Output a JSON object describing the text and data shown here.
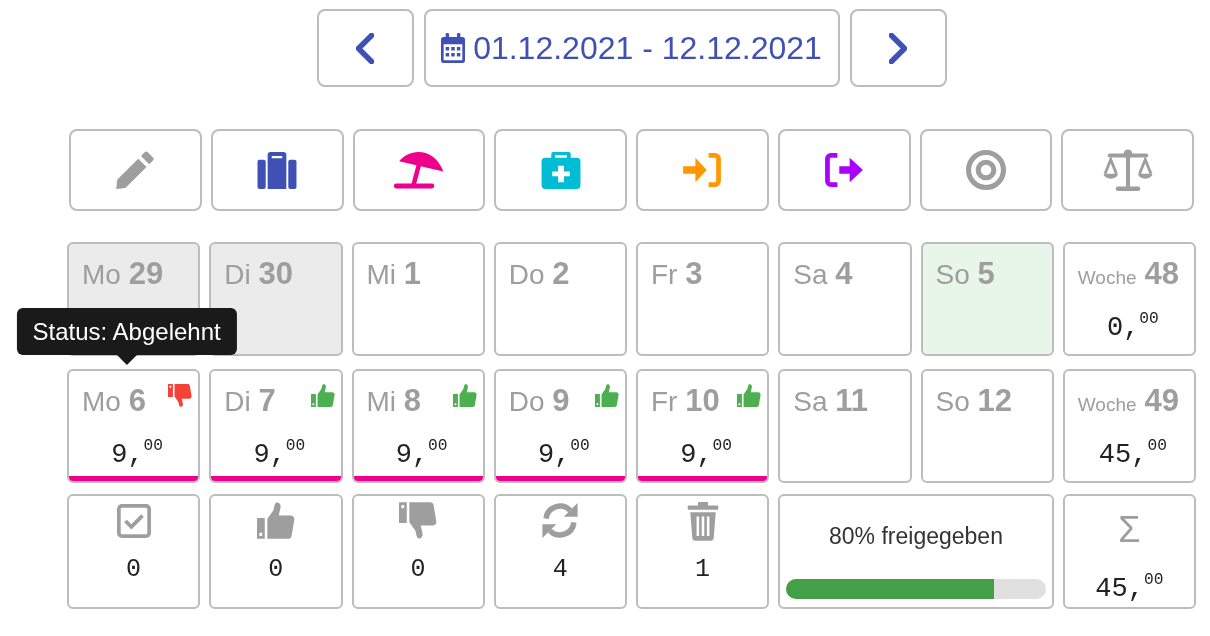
{
  "date_range": {
    "label": "01.12.2021 - 12.12.2021"
  },
  "tools": [
    {
      "kind": "edit",
      "color": "#9e9e9e"
    },
    {
      "kind": "trip",
      "color": "#3f51b5"
    },
    {
      "kind": "vacation",
      "color": "#ec008c"
    },
    {
      "kind": "sick",
      "color": "#00bcd4"
    },
    {
      "kind": "arrival",
      "color": "#ff9800"
    },
    {
      "kind": "departure",
      "color": "#aa00ff"
    },
    {
      "kind": "target",
      "color": "#9e9e9e"
    },
    {
      "kind": "balance",
      "color": "#9e9e9e"
    }
  ],
  "weeks": [
    {
      "days": [
        {
          "weekday": "Mo",
          "day": "29",
          "outside": true,
          "highlighted": false
        },
        {
          "weekday": "Di",
          "day": "30",
          "outside": true,
          "highlighted": false
        },
        {
          "weekday": "Mi",
          "day": "1",
          "outside": false,
          "highlighted": false
        },
        {
          "weekday": "Do",
          "day": "2",
          "outside": false,
          "highlighted": false
        },
        {
          "weekday": "Fr",
          "day": "3",
          "outside": false,
          "highlighted": false
        },
        {
          "weekday": "Sa",
          "day": "4",
          "outside": false,
          "highlighted": false
        },
        {
          "weekday": "So",
          "day": "5",
          "outside": false,
          "highlighted": true
        }
      ],
      "summary": {
        "label": "Woche",
        "number": "48",
        "total": "0,$^{00}$"
      }
    },
    {
      "days": [
        {
          "weekday": "Mo",
          "day": "6",
          "outside": false,
          "highlighted": false,
          "status": {
            "kind": "rejected"
          },
          "tooltip": "Status: Abgelehnt",
          "hours": "9,$^{00}$",
          "color": "#ec008c"
        },
        {
          "weekday": "Di",
          "day": "7",
          "outside": false,
          "highlighted": false,
          "status": {
            "kind": "approved"
          },
          "hours": "9,$^{00}$",
          "color": "#ec008c"
        },
        {
          "weekday": "Mi",
          "day": "8",
          "outside": false,
          "highlighted": false,
          "status": {
            "kind": "approved"
          },
          "hours": "9,$^{00}$",
          "color": "#ec008c"
        },
        {
          "weekday": "Do",
          "day": "9",
          "outside": false,
          "highlighted": false,
          "status": {
            "kind": "approved"
          },
          "hours": "9,$^{00}$",
          "color": "#ec008c"
        },
        {
          "weekday": "Fr",
          "day": "10",
          "outside": false,
          "highlighted": false,
          "status": {
            "kind": "approved"
          },
          "hours": "9,$^{00}$",
          "color": "#ec008c"
        },
        {
          "weekday": "Sa",
          "day": "11",
          "outside": false,
          "highlighted": false
        },
        {
          "weekday": "So",
          "day": "12",
          "outside": false,
          "highlighted": false
        }
      ],
      "summary": {
        "label": "Woche",
        "number": "49",
        "total": "45,$^{00}$"
      }
    }
  ],
  "totals": {
    "counters": [
      {
        "kind": "checked",
        "count": "0"
      },
      {
        "kind": "approved",
        "count": "0"
      },
      {
        "kind": "rejected",
        "count": "0"
      },
      {
        "kind": "pending",
        "count": "4"
      },
      {
        "kind": "deleted",
        "count": "1"
      }
    ],
    "progress": {
      "label": "80% freigegeben",
      "level": 0.8
    },
    "sum": {
      "symbol": "Σ",
      "value": "45,$^{00}$"
    }
  }
}
